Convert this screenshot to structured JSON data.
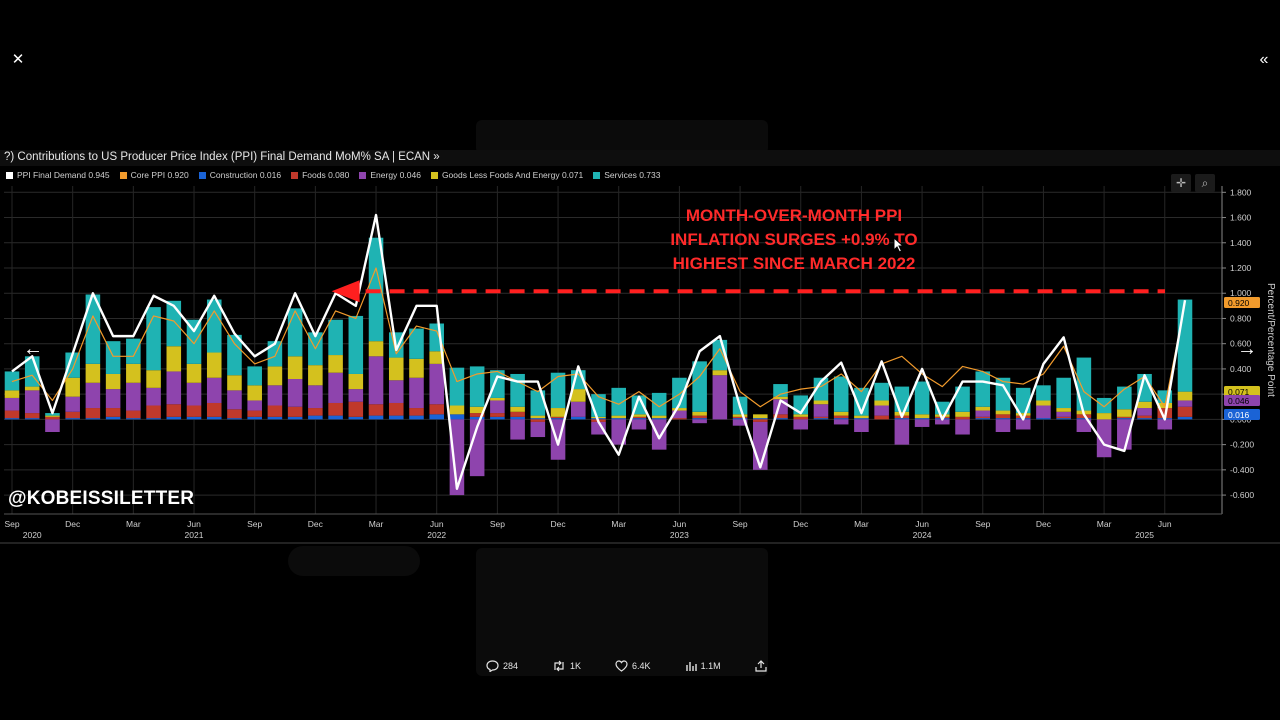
{
  "window": {
    "close_icon": "close-icon",
    "collapse_icon": "double-chevron-icon"
  },
  "chart": {
    "title": "?) Contributions to US Producer Price Index (PPI) Final Demand MoM% SA | ECAN »",
    "watermark": "@KOBEISSILETTER",
    "annotation_lines": [
      "MONTH-OVER-MONTH PPI",
      "INFLATION SURGES +0.9% TO",
      "HIGHEST SINCE MARCH 2022"
    ],
    "legend": [
      {
        "label": "PPI Final Demand 0.945",
        "color": "#ffffff"
      },
      {
        "label": "Core PPI 0.920",
        "color": "#f29b2c"
      },
      {
        "label": "Construction 0.016",
        "color": "#1a63d6"
      },
      {
        "label": "Foods 0.080",
        "color": "#c0392b"
      },
      {
        "label": "Energy 0.046",
        "color": "#8e44ad"
      },
      {
        "label": "Goods Less Foods And Energy 0.071",
        "color": "#d4c11e"
      },
      {
        "label": "Services 0.733",
        "color": "#1fb3b3"
      }
    ],
    "y_axis_title": "Percent/Percentage Point",
    "right_tags": [
      {
        "text": "0.920",
        "color": "#f29b2c"
      },
      {
        "text": "0.071",
        "color": "#d4c11e"
      },
      {
        "text": "0.046",
        "color": "#8e44ad"
      },
      {
        "text": "0.016",
        "color": "#1a63d6"
      }
    ]
  },
  "chart_data": {
    "type": "bar",
    "ylabel": "Percent/Percentage Point",
    "ylim": [
      -0.75,
      1.85
    ],
    "yticks": [
      1.8,
      1.6,
      1.4,
      1.2,
      1.0,
      0.8,
      0.6,
      0.4,
      0.2,
      0.0,
      -0.2,
      -0.4,
      -0.6
    ],
    "ytick_labels": [
      "1.800",
      "1.600",
      "1.400",
      "1.200",
      "1.000",
      "0.800",
      "0.600",
      "0.400",
      "0.200",
      "0.000",
      "-0.200",
      "-0.400",
      "-0.600"
    ],
    "month_ticks": [
      "Sep",
      "Dec",
      "Mar",
      "Jun",
      "Sep",
      "Dec",
      "Mar",
      "Jun",
      "Sep",
      "Dec",
      "Mar",
      "Jun",
      "Sep",
      "Dec",
      "Mar",
      "Jun",
      "Sep",
      "Dec",
      "Mar",
      "Jun"
    ],
    "month_tick_index": [
      0,
      3,
      6,
      9,
      12,
      15,
      18,
      21,
      24,
      27,
      30,
      33,
      36,
      39,
      42,
      45,
      48,
      51,
      54,
      57
    ],
    "year_labels": [
      {
        "label": "2020",
        "index": 1
      },
      {
        "label": "2021",
        "index": 9
      },
      {
        "label": "2022",
        "index": 21
      },
      {
        "label": "2023",
        "index": 33
      },
      {
        "label": "2024",
        "index": 45
      },
      {
        "label": "2025",
        "index": 56
      }
    ],
    "stack_order": [
      "Construction",
      "Foods",
      "Energy",
      "Goods Less Foods And Energy",
      "Services"
    ],
    "colors": {
      "Construction": "#1a63d6",
      "Foods": "#c0392b",
      "Energy": "#8e44ad",
      "Goods Less Foods And Energy": "#d4c11e",
      "Services": "#1fb3b3",
      "PPI Final Demand": "#ffffff",
      "Core PPI": "#f29b2c"
    },
    "series": [
      {
        "name": "Construction",
        "values": [
          0.01,
          0.01,
          0.0,
          0.01,
          0.01,
          0.02,
          0.01,
          0.01,
          0.02,
          0.02,
          0.02,
          0.01,
          0.02,
          0.02,
          0.02,
          0.03,
          0.03,
          0.02,
          0.03,
          0.03,
          0.03,
          0.04,
          0.04,
          0.02,
          0.02,
          0.02,
          0.01,
          0.01,
          0.02,
          0.01,
          0.01,
          0.01,
          0.01,
          0.0,
          0.01,
          0.0,
          0.01,
          0.01,
          0.01,
          0.0,
          0.01,
          0.01,
          0.01,
          0.0,
          0.01,
          0.01,
          0.01,
          0.0,
          0.01,
          0.01,
          0.01,
          0.01,
          0.01,
          0.01,
          0.0,
          0.01,
          0.01,
          0.01,
          0.02
        ]
      },
      {
        "name": "Foods",
        "values": [
          0.06,
          0.04,
          0.02,
          0.05,
          0.08,
          0.07,
          0.06,
          0.1,
          0.1,
          0.09,
          0.11,
          0.07,
          0.05,
          0.09,
          0.08,
          0.06,
          0.1,
          0.12,
          0.09,
          0.1,
          0.06,
          0.08,
          0.0,
          0.03,
          0.03,
          0.04,
          -0.02,
          0.01,
          0.0,
          -0.02,
          0.0,
          0.01,
          0.0,
          0.01,
          0.02,
          0.0,
          0.01,
          -0.02,
          0.03,
          0.02,
          0.01,
          0.02,
          0.0,
          0.03,
          0.02,
          0.0,
          0.01,
          0.02,
          0.01,
          0.03,
          0.02,
          0.0,
          0.01,
          0.03,
          0.0,
          0.01,
          0.02,
          0.08,
          0.08
        ]
      },
      {
        "name": "Energy",
        "values": [
          0.1,
          0.18,
          -0.1,
          0.12,
          0.2,
          0.15,
          0.22,
          0.14,
          0.26,
          0.18,
          0.2,
          0.15,
          0.08,
          0.16,
          0.22,
          0.18,
          0.24,
          0.1,
          0.38,
          0.18,
          0.24,
          0.32,
          -0.6,
          -0.45,
          0.1,
          -0.16,
          -0.12,
          -0.32,
          0.12,
          -0.1,
          -0.2,
          -0.08,
          -0.24,
          0.06,
          -0.03,
          0.35,
          -0.05,
          -0.38,
          0.12,
          -0.08,
          0.1,
          -0.04,
          -0.1,
          0.08,
          -0.2,
          -0.06,
          -0.04,
          -0.12,
          0.05,
          -0.1,
          -0.08,
          0.1,
          0.04,
          -0.1,
          -0.3,
          -0.24,
          0.06,
          -0.08,
          0.05
        ]
      },
      {
        "name": "Goods Less Foods And Energy",
        "values": [
          0.06,
          0.03,
          0.01,
          0.15,
          0.15,
          0.12,
          0.15,
          0.14,
          0.2,
          0.15,
          0.2,
          0.12,
          0.12,
          0.15,
          0.18,
          0.16,
          0.14,
          0.12,
          0.12,
          0.18,
          0.15,
          0.1,
          0.07,
          0.05,
          0.02,
          0.04,
          0.02,
          0.07,
          0.1,
          0.01,
          0.02,
          0.02,
          0.02,
          0.02,
          0.03,
          0.04,
          0.02,
          0.03,
          0.02,
          0.02,
          0.03,
          0.03,
          0.02,
          0.04,
          0.03,
          0.03,
          0.02,
          0.04,
          0.03,
          0.03,
          0.02,
          0.04,
          0.03,
          0.03,
          0.05,
          0.06,
          0.05,
          0.04,
          0.07
        ]
      },
      {
        "name": "Services",
        "values": [
          0.15,
          0.24,
          0.02,
          0.2,
          0.55,
          0.26,
          0.2,
          0.5,
          0.36,
          0.35,
          0.42,
          0.32,
          0.15,
          0.2,
          0.38,
          0.26,
          0.28,
          0.46,
          0.82,
          0.2,
          0.24,
          0.22,
          0.3,
          0.32,
          0.22,
          0.26,
          0.2,
          0.28,
          0.15,
          0.18,
          0.22,
          0.15,
          0.18,
          0.24,
          0.4,
          0.24,
          0.14,
          0.0,
          0.1,
          0.15,
          0.18,
          0.28,
          0.22,
          0.14,
          0.2,
          0.26,
          0.1,
          0.2,
          0.28,
          0.26,
          0.2,
          0.12,
          0.24,
          0.42,
          0.12,
          0.18,
          0.22,
          0.1,
          0.73
        ]
      },
      {
        "name": "PPI Final Demand",
        "values": [
          0.38,
          0.5,
          0.05,
          0.52,
          1.0,
          0.66,
          0.66,
          0.98,
          0.9,
          0.7,
          0.98,
          0.68,
          0.5,
          0.6,
          1.0,
          0.66,
          1.0,
          0.9,
          1.62,
          0.55,
          0.9,
          0.9,
          -0.55,
          -0.06,
          0.34,
          0.3,
          0.3,
          -0.2,
          0.42,
          -0.02,
          -0.28,
          0.18,
          -0.15,
          0.12,
          0.54,
          0.66,
          0.1,
          -0.38,
          0.15,
          0.05,
          0.3,
          0.45,
          0.05,
          0.46,
          0.02,
          0.4,
          0.0,
          0.3,
          0.3,
          0.27,
          0.0,
          0.44,
          0.65,
          0.04,
          -0.2,
          -0.25,
          0.35,
          0.0,
          0.945
        ]
      },
      {
        "name": "Core PPI",
        "values": [
          0.3,
          0.35,
          0.15,
          0.4,
          0.82,
          0.5,
          0.5,
          0.82,
          0.78,
          0.6,
          0.86,
          0.6,
          0.44,
          0.5,
          0.86,
          0.56,
          0.86,
          0.8,
          1.2,
          0.52,
          0.74,
          0.7,
          0.3,
          0.36,
          0.38,
          0.3,
          0.22,
          0.34,
          0.36,
          0.18,
          0.12,
          0.22,
          0.1,
          0.2,
          0.34,
          0.56,
          0.22,
          0.1,
          0.2,
          0.24,
          0.26,
          0.36,
          0.22,
          0.44,
          0.5,
          0.36,
          0.26,
          0.42,
          0.38,
          0.3,
          0.28,
          0.36,
          0.58,
          0.22,
          0.1,
          0.24,
          0.34,
          0.1,
          0.92
        ]
      }
    ],
    "reference_level": 1.0,
    "reference_start_index": 33
  },
  "actions": {
    "replies": "284",
    "reposts": "1K",
    "likes": "6.4K",
    "views": "1.1M"
  }
}
